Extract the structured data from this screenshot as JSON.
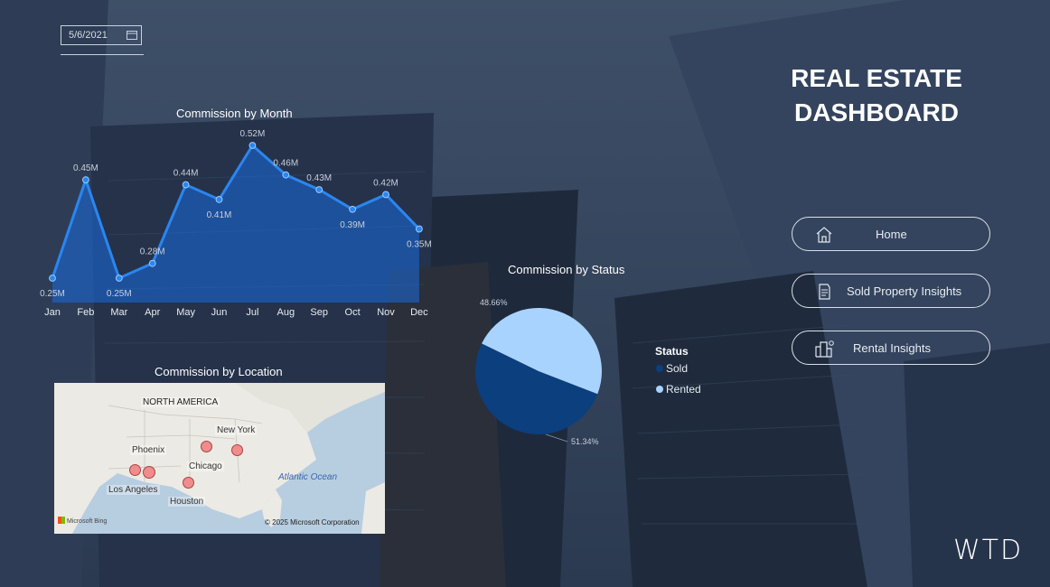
{
  "filters": {
    "date": "5/6/2021"
  },
  "dashboard": {
    "title_line1": "REAL ESTATE",
    "title_line2": "DASHBOARD",
    "brand": "WTD"
  },
  "nav": [
    {
      "label": "Home",
      "icon": "house-icon"
    },
    {
      "label": "Sold Property Insights",
      "icon": "receipt-icon"
    },
    {
      "label": "Rental Insights",
      "icon": "buildings-icon"
    }
  ],
  "line_chart_title": "Commission by Month",
  "pie_chart_title": "Commission by Status",
  "map_chart_title": "Commission by Location",
  "colors": {
    "line": "#2a86f0",
    "area": "#1a6be0",
    "sold": "#0b3f7e",
    "rented": "#a9d3ff",
    "marker": "#f08c8c"
  },
  "chart_data": [
    {
      "type": "line",
      "categories": [
        "Jan",
        "Feb",
        "Mar",
        "Apr",
        "May",
        "Jun",
        "Jul",
        "Aug",
        "Sep",
        "Oct",
        "Nov",
        "Dec"
      ],
      "values": [
        0.25,
        0.45,
        0.25,
        0.28,
        0.44,
        0.41,
        0.52,
        0.46,
        0.43,
        0.39,
        0.42,
        0.35
      ],
      "labels": [
        "0.25M",
        "0.45M",
        "0.25M",
        "0.28M",
        "0.44M",
        "0.41M",
        "0.52M",
        "0.46M",
        "0.43M",
        "0.39M",
        "0.42M",
        "0.35M"
      ],
      "title": "Commission by Month",
      "area": true
    },
    {
      "type": "pie",
      "title": "Commission by Status",
      "legend_title": "Status",
      "categories": [
        "Sold",
        "Rented"
      ],
      "values": [
        51.34,
        48.66
      ],
      "labels": [
        "51.34%",
        "48.66%"
      ]
    }
  ],
  "map": {
    "region_label": "NORTH AMERICA",
    "ocean_label": "Atlantic Ocean",
    "cities": [
      "New York",
      "Phoenix",
      "Chicago",
      "Los Angeles",
      "Houston"
    ],
    "attribution": "© 2025 Microsoft Corporation",
    "provider": "Microsoft Bing"
  }
}
